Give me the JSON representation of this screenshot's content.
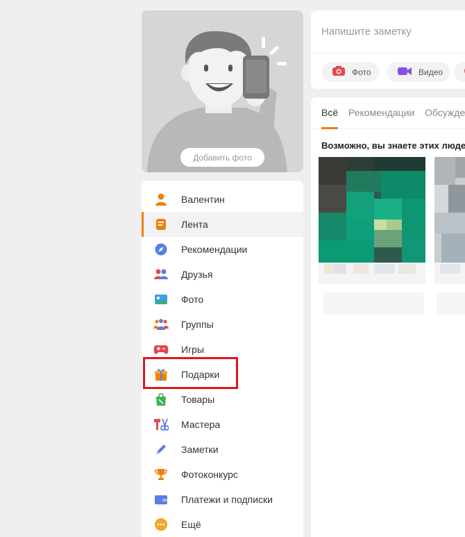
{
  "profile": {
    "add_photo_label": "Добавить фото"
  },
  "nav": {
    "items": [
      {
        "label": "Валентин",
        "icon": "user-icon",
        "color": "#ee8208"
      },
      {
        "label": "Лента",
        "icon": "feed-icon",
        "color": "#ee8208",
        "active": true
      },
      {
        "label": "Рекомендации",
        "icon": "compass-icon",
        "color": "#5a7de6"
      },
      {
        "label": "Друзья",
        "icon": "friends-icon",
        "color": "#5a7de6"
      },
      {
        "label": "Фото",
        "icon": "photo-icon",
        "color": "#3ea0e0"
      },
      {
        "label": "Группы",
        "icon": "groups-icon",
        "color": "#5a7de6"
      },
      {
        "label": "Игры",
        "icon": "gamepad-icon",
        "color": "#e5484d"
      },
      {
        "label": "Подарки",
        "icon": "gift-icon",
        "color": "#ee8208"
      },
      {
        "label": "Товары",
        "icon": "shopping-bag-icon",
        "color": "#3fb34f"
      },
      {
        "label": "Мастера",
        "icon": "tools-icon",
        "color": "#e5484d"
      },
      {
        "label": "Заметки",
        "icon": "pencil-icon",
        "color": "#5a7de6"
      },
      {
        "label": "Фотоконкурс",
        "icon": "trophy-icon",
        "color": "#ee8208"
      },
      {
        "label": "Платежи и подписки",
        "icon": "wallet-icon",
        "color": "#5a7de6"
      },
      {
        "label": "Ещё",
        "icon": "more-icon",
        "color": "#ee8208"
      }
    ]
  },
  "composer": {
    "placeholder": "Напишите заметку",
    "photo_label": "Фото",
    "video_label": "Видео"
  },
  "feed": {
    "tabs": [
      "Всё",
      "Рекомендации",
      "Обсуждения"
    ],
    "active_tab": "Всё",
    "suggest_title": "Возможно, вы знаете этих людей"
  },
  "colors": {
    "accent": "#ee8208",
    "highlight": "#e0161d"
  }
}
